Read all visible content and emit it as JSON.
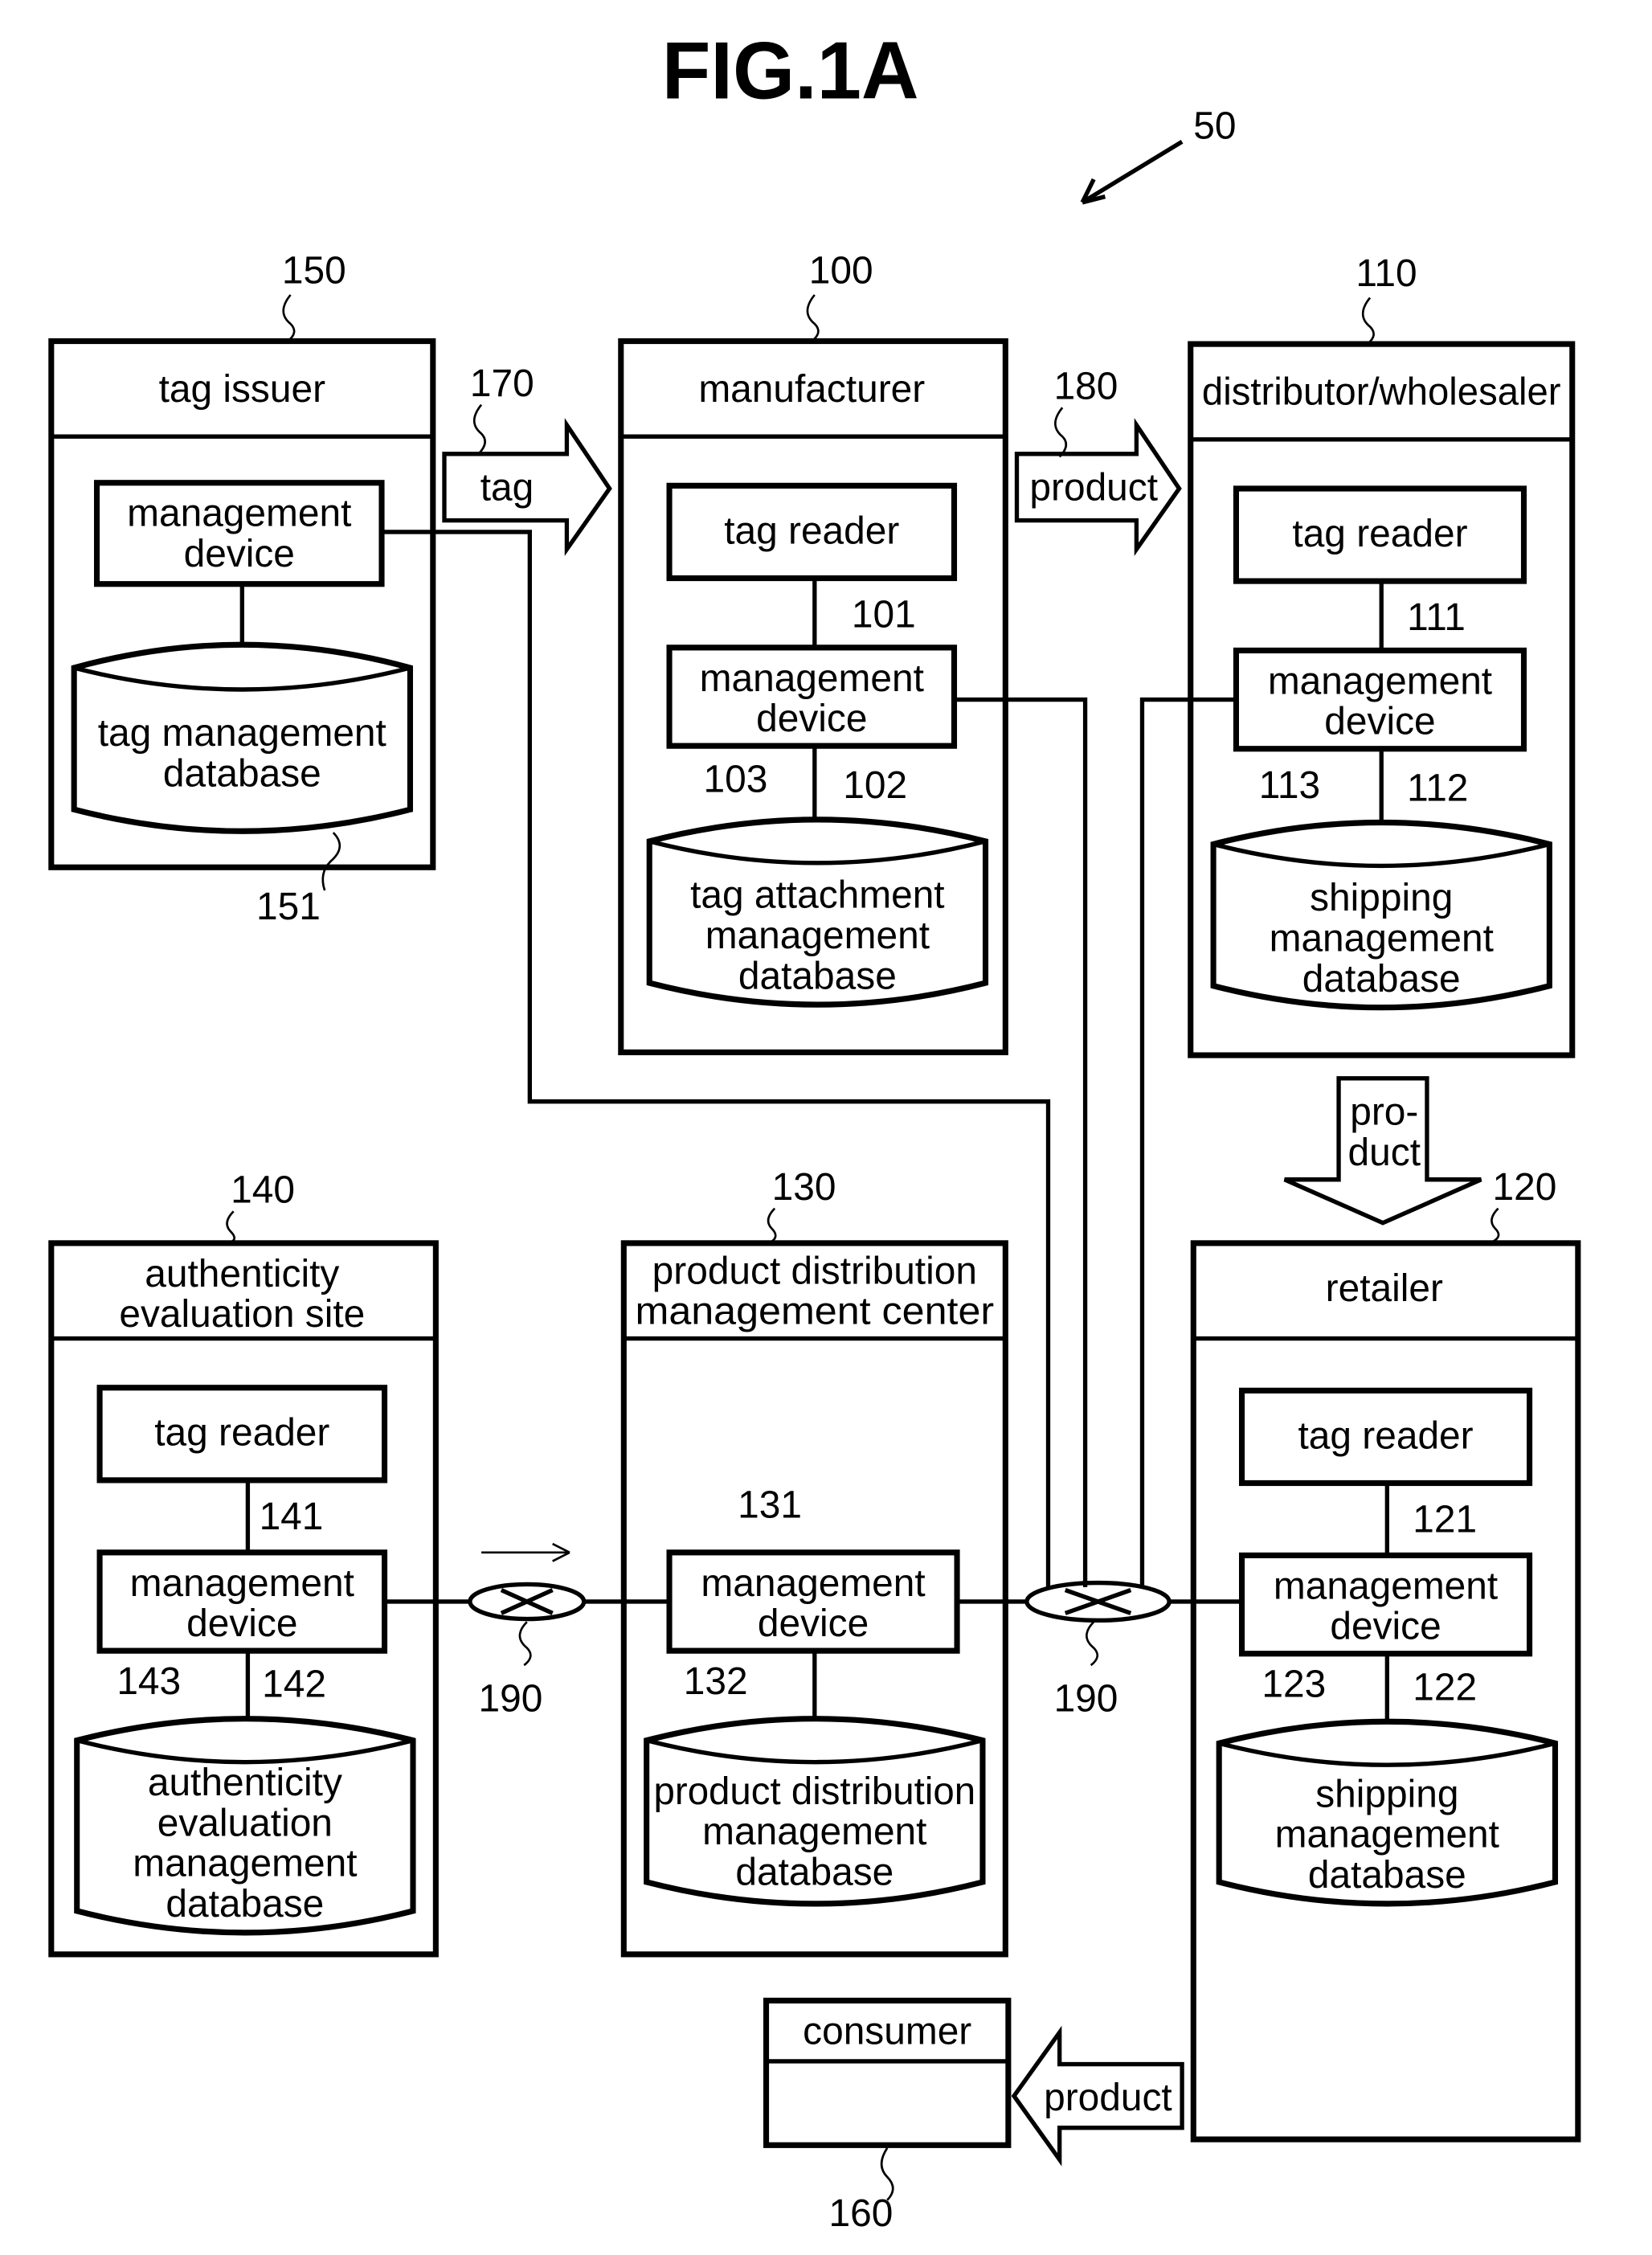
{
  "figure": {
    "title": "FIG.1A",
    "system_ref": "50"
  },
  "nodes": {
    "tag_issuer": {
      "ref": "150",
      "title": "tag issuer",
      "device": [
        "management",
        "device"
      ],
      "db": [
        "tag management",
        "database"
      ],
      "db_ref": "151"
    },
    "manufacturer": {
      "ref": "100",
      "title": "manufacturer",
      "reader": "tag reader",
      "reader_ref": "101",
      "device": [
        "management",
        "device"
      ],
      "device_ref": "102",
      "db_ref": "103",
      "db": [
        "tag attachment",
        "management",
        "database"
      ]
    },
    "distributor": {
      "ref": "110",
      "title": "distributor/wholesaler",
      "reader": "tag reader",
      "reader_ref": "111",
      "device": [
        "management",
        "device"
      ],
      "device_ref": "112",
      "db_ref": "113",
      "db": [
        "shipping",
        "management",
        "database"
      ]
    },
    "authenticity": {
      "ref": "140",
      "title": [
        "authenticity",
        "evaluation site"
      ],
      "reader": "tag reader",
      "reader_ref": "141",
      "device": [
        "management",
        "device"
      ],
      "device_ref": "142",
      "db_ref": "143",
      "db": [
        "authenticity",
        "evaluation",
        "management",
        "database"
      ]
    },
    "center": {
      "ref": "130",
      "title": [
        "product distribution",
        "management center"
      ],
      "device": [
        "management",
        "device"
      ],
      "device_ref": "131",
      "db_ref": "132",
      "db": [
        "product distribution",
        "management",
        "database"
      ]
    },
    "retailer": {
      "ref": "120",
      "title": "retailer",
      "reader": "tag reader",
      "reader_ref": "121",
      "device": [
        "management",
        "device"
      ],
      "device_ref": "122",
      "db_ref": "123",
      "db": [
        "shipping",
        "management",
        "database"
      ]
    },
    "consumer": {
      "ref": "160",
      "title": "consumer"
    }
  },
  "flows": {
    "tag": {
      "ref": "170",
      "label": "tag"
    },
    "product1": {
      "ref": "180",
      "label": "product"
    },
    "product2": {
      "label": [
        "pro-",
        "duct"
      ]
    },
    "product3": {
      "label": "product"
    }
  },
  "network": {
    "left_ref": "190",
    "right_ref": "190"
  }
}
